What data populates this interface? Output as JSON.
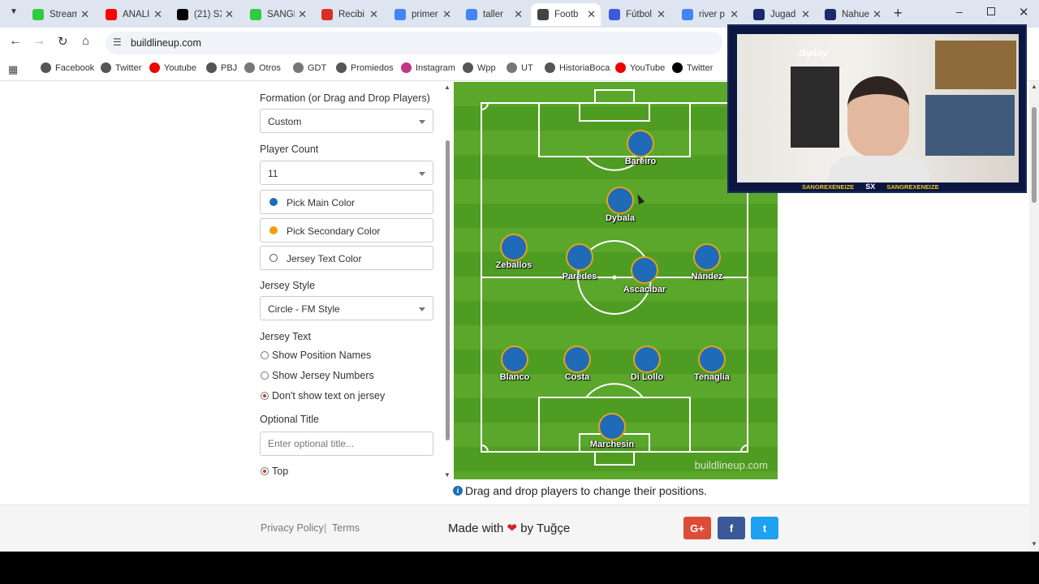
{
  "tabs": [
    {
      "label": "Stream",
      "icon": "kick-icon",
      "color": "#2ecc40"
    },
    {
      "label": "ANALI",
      "icon": "youtube-icon",
      "color": "#ff0000"
    },
    {
      "label": "(21) SX",
      "icon": "x-icon",
      "color": "#000000"
    },
    {
      "label": "SANGR",
      "icon": "kick-icon",
      "color": "#2ecc40"
    },
    {
      "label": "Recibi",
      "icon": "gmail-icon",
      "color": "#d93025"
    },
    {
      "label": "primer",
      "icon": "google-icon",
      "color": "#4285f4"
    },
    {
      "label": "taller",
      "icon": "google-icon",
      "color": "#4285f4"
    },
    {
      "label": "Footb",
      "icon": "football-icon",
      "color": "#444444"
    },
    {
      "label": "Fútbol",
      "icon": "doc-icon",
      "color": "#3b5bdb"
    },
    {
      "label": "river p",
      "icon": "google-icon",
      "color": "#4285f4"
    },
    {
      "label": "Jugad",
      "icon": "tm-icon",
      "color": "#1a2a6c"
    },
    {
      "label": "Nahue",
      "icon": "tm-icon",
      "color": "#1a2a6c"
    }
  ],
  "address": "buildlineup.com",
  "bookmarks": [
    "Facebook",
    "Twitter",
    "Youtube",
    "PBJ",
    "Otros",
    "GDT",
    "Promiedos",
    "Instagram",
    "Wpp",
    "UT",
    "HistoriaBoca",
    "YouTube",
    "Twitter"
  ],
  "form": {
    "formation_label": "Formation (or Drag and Drop Players)",
    "formation_value": "Custom",
    "player_count_label": "Player Count",
    "player_count_value": "11",
    "main_color_label": "Pick Main Color",
    "secondary_color_label": "Pick Secondary Color",
    "text_color_label": "Jersey Text Color",
    "jersey_style_label": "Jersey Style",
    "jersey_style_value": "Circle - FM Style",
    "jersey_text_label": "Jersey Text",
    "opt_position": "Show Position Names",
    "opt_numbers": "Show Jersey Numbers",
    "opt_none": "Don't show text on jersey",
    "optional_title_label": "Optional Title",
    "optional_title_placeholder": "Enter optional title...",
    "title_position": "Top"
  },
  "colors": {
    "main": "#1f6bb8",
    "secondary": "#f39c12",
    "text": "#ffffff"
  },
  "players": [
    "Bareiro",
    "Dybala",
    "Zeballos",
    "Paredes",
    "Ascacibar",
    "Nández",
    "Blanco",
    "Costa",
    "Di Lollo",
    "Tenaglia",
    "Marchesin"
  ],
  "watermark": "buildlineup.com",
  "hint": "Drag and drop players to change their positions.",
  "footer": {
    "privacy": "Privacy Policy",
    "sep": "|",
    "terms": "Terms",
    "made_with": "Made with",
    "by": "by Tuğçe",
    "gplus": "G+",
    "fb": "f",
    "tw": "t"
  },
  "overlay": {
    "brand": "tbplay",
    "handle1": "SANGREXENEIZE",
    "handle2": "SX",
    "handle3": "SANGREXENEIZE"
  }
}
